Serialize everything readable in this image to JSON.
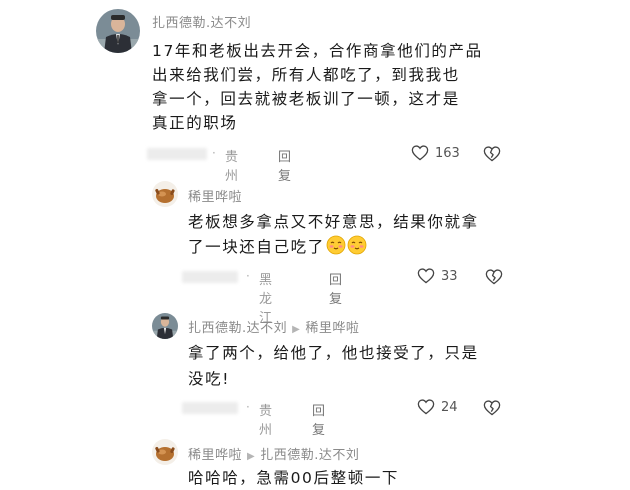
{
  "comments": [
    {
      "author": "扎西德勒.达不刘",
      "lines": [
        "17年和老板出去开会，合作商拿他们的产品",
        "出来给我们尝，所有人都吃了，到我我也",
        "拿一个，回去就被老板训了一顿，这才是",
        "真正的职场"
      ],
      "location": "贵州",
      "reply_label": "回复",
      "likes": "163"
    },
    {
      "author": "稀里哗啦",
      "lines": [
        "老板想多拿点又不好意思，结果你就拿",
        "了一块还自己吃了"
      ],
      "location": "黑龙江",
      "reply_label": "回复",
      "likes": "33"
    },
    {
      "author": "扎西德勒.达不刘",
      "reply_to": "稀里哗啦",
      "lines": [
        "拿了两个，给他了，他也接受了，只是",
        "没吃!"
      ],
      "location": "贵州",
      "reply_label": "回复",
      "likes": "24"
    },
    {
      "author": "稀里哗啦",
      "reply_to": "扎西德勒.达不刘",
      "lines": [
        "哈哈哈，急需00后整顿一下"
      ]
    }
  ],
  "icons": {
    "like": "heart-outline-icon",
    "dislike": "broken-heart-icon",
    "reply_arrow": "triangle-right-icon",
    "emoji": "shy-smile-emoji"
  }
}
